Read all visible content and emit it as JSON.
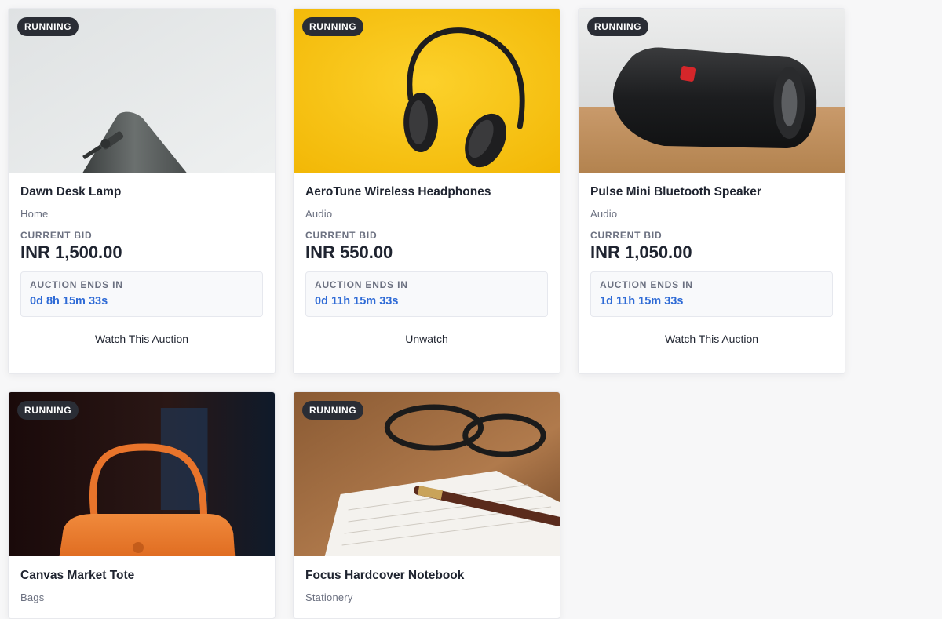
{
  "auctions": [
    {
      "status": "RUNNING",
      "title": "Dawn Desk Lamp",
      "category": "Home",
      "current_bid_label": "CURRENT BID",
      "current_bid": "INR 1,500.00",
      "ends_label": "AUCTION ENDS IN",
      "ends_in": "0d 8h 15m 33s",
      "watch_label": "Watch This Auction"
    },
    {
      "status": "RUNNING",
      "title": "AeroTune Wireless Headphones",
      "category": "Audio",
      "current_bid_label": "CURRENT BID",
      "current_bid": "INR 550.00",
      "ends_label": "AUCTION ENDS IN",
      "ends_in": "0d 11h 15m 33s",
      "watch_label": "Unwatch"
    },
    {
      "status": "RUNNING",
      "title": "Pulse Mini Bluetooth Speaker",
      "category": "Audio",
      "current_bid_label": "CURRENT BID",
      "current_bid": "INR 1,050.00",
      "ends_label": "AUCTION ENDS IN",
      "ends_in": "1d 11h 15m 33s",
      "watch_label": "Watch This Auction"
    },
    {
      "status": "RUNNING",
      "title": "Canvas Market Tote",
      "category": "Bags"
    },
    {
      "status": "RUNNING",
      "title": "Focus Hardcover Notebook",
      "category": "Stationery"
    }
  ],
  "colors": {
    "accent": "#2f6bd6",
    "badge_bg": "#2a2d35",
    "page_bg": "#f7f7f8"
  },
  "icons": [
    "lamp-image",
    "headphones-image",
    "speaker-image",
    "tote-bag-image",
    "notebook-image"
  ]
}
